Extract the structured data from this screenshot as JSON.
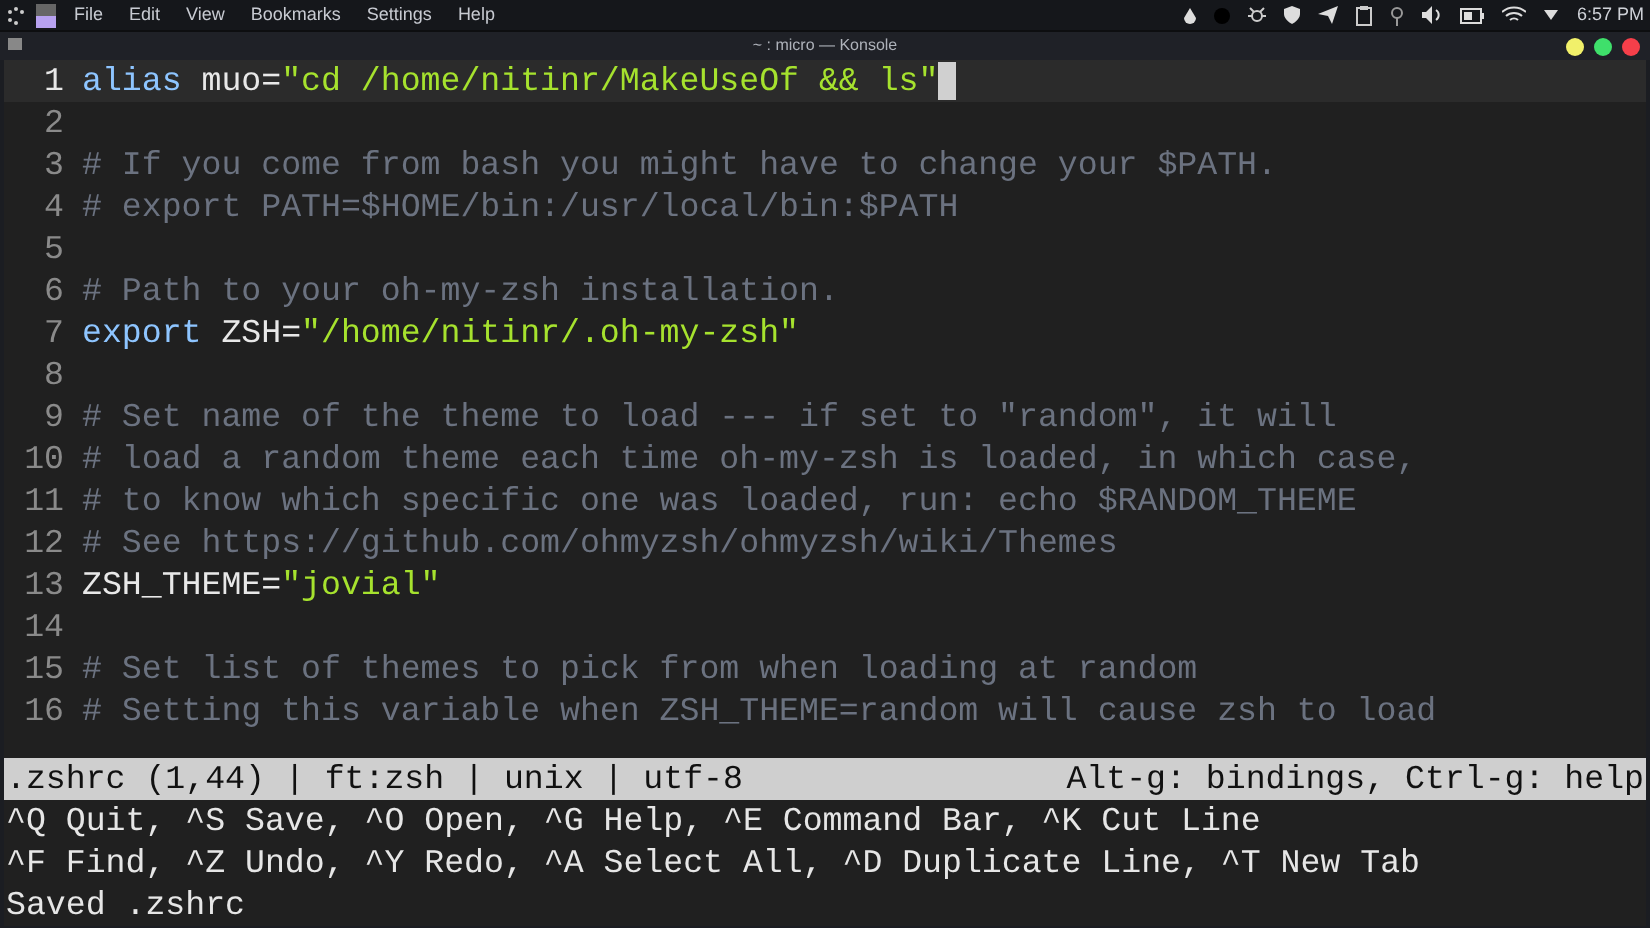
{
  "menu_bar": {
    "items": [
      "File",
      "Edit",
      "View",
      "Bookmarks",
      "Settings",
      "Help"
    ],
    "clock": "6:57 PM"
  },
  "window": {
    "title": "~ : micro — Konsole"
  },
  "editor": {
    "lines": [
      {
        "number": "1",
        "current": true,
        "segments": [
          {
            "kind": "keyword",
            "text": "alias"
          },
          {
            "kind": "plain",
            "text": " muo="
          },
          {
            "kind": "string",
            "text": "\"cd /home/nitinr/MakeUseOf && ls\""
          }
        ]
      },
      {
        "number": "2",
        "current": false
      },
      {
        "number": "3",
        "current": false,
        "segments": [
          {
            "kind": "comment",
            "text": "# If you come from bash you might have to change your $PATH."
          }
        ]
      },
      {
        "number": "4",
        "current": false,
        "segments": [
          {
            "kind": "comment",
            "text": "# export PATH=$HOME/bin:/usr/local/bin:$PATH"
          }
        ]
      },
      {
        "number": "5",
        "current": false
      },
      {
        "number": "6",
        "current": false,
        "segments": [
          {
            "kind": "comment",
            "text": "# Path to your oh-my-zsh installation."
          }
        ]
      },
      {
        "number": "7",
        "current": false,
        "segments": [
          {
            "kind": "keyword",
            "text": "export"
          },
          {
            "kind": "plain",
            "text": " ZSH="
          },
          {
            "kind": "string",
            "text": "\"/home/nitinr/.oh-my-zsh\""
          }
        ]
      },
      {
        "number": "8",
        "current": false
      },
      {
        "number": "9",
        "current": false,
        "segments": [
          {
            "kind": "comment",
            "text": "# Set name of the theme to load --- if set to \"random\", it will"
          }
        ]
      },
      {
        "number": "10",
        "current": false,
        "segments": [
          {
            "kind": "comment",
            "text": "# load a random theme each time oh-my-zsh is loaded, in which case,"
          }
        ]
      },
      {
        "number": "11",
        "current": false,
        "segments": [
          {
            "kind": "comment",
            "text": "# to know which specific one was loaded, run: echo $RANDOM_THEME"
          }
        ]
      },
      {
        "number": "12",
        "current": false,
        "segments": [
          {
            "kind": "comment",
            "text": "# See https://github.com/ohmyzsh/ohmyzsh/wiki/Themes"
          }
        ]
      },
      {
        "number": "13",
        "current": false,
        "segments": [
          {
            "kind": "plain",
            "text": "ZSH_THEME="
          },
          {
            "kind": "string",
            "text": "\"jovial\""
          }
        ]
      },
      {
        "number": "14",
        "current": false
      },
      {
        "number": "15",
        "current": false,
        "segments": [
          {
            "kind": "comment",
            "text": "# Set list of themes to pick from when loading at random"
          }
        ]
      },
      {
        "number": "16",
        "current": false,
        "segments": [
          {
            "kind": "comment",
            "text": "# Setting this variable when ZSH_THEME=random will cause zsh to load"
          }
        ]
      }
    ]
  },
  "status_bar": {
    "left": ".zshrc (1,44) | ft:zsh | unix | utf-8",
    "right": "Alt-g: bindings, Ctrl-g: help"
  },
  "help_lines": [
    "^Q Quit, ^S Save, ^O Open, ^G Help, ^E Command Bar, ^K Cut Line",
    "^F Find, ^Z Undo, ^Y Redo, ^A Select All, ^D Duplicate Line, ^T New Tab"
  ],
  "message": "Saved .zshrc"
}
